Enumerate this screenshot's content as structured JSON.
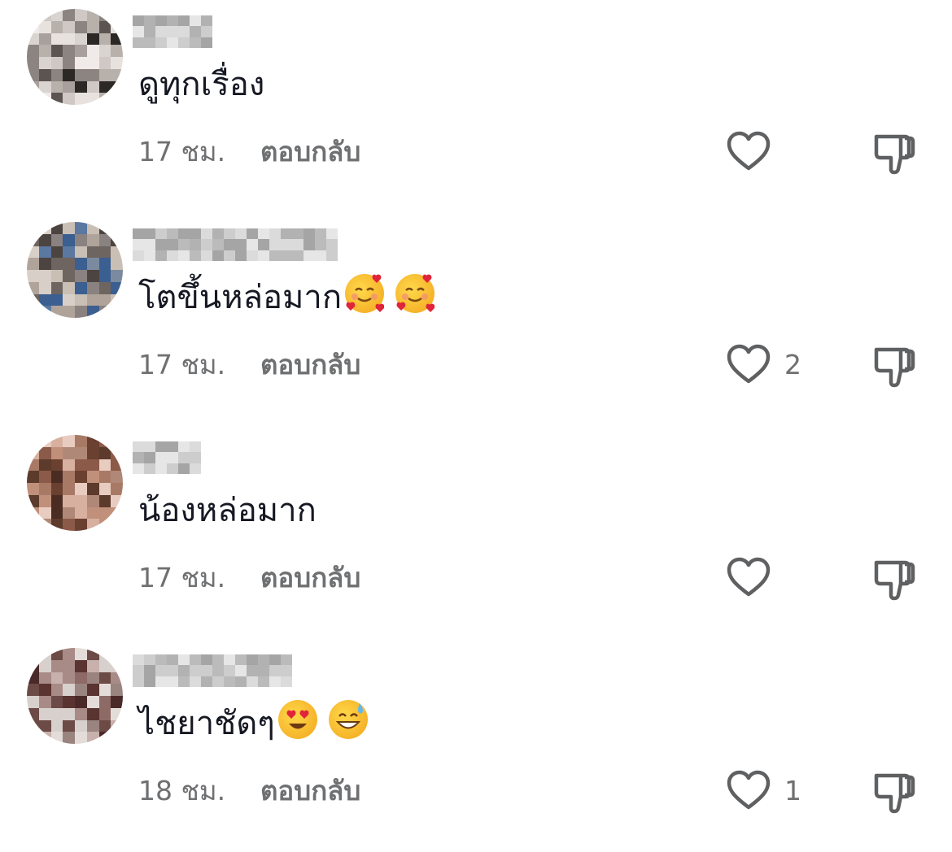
{
  "comments": [
    {
      "text": "ดูทุกเรื่อง",
      "time": "17 ชม.",
      "reply_label": "ตอบกลับ",
      "like_count": "",
      "emojis": []
    },
    {
      "text": "โตขึ้นหล่อมาก",
      "time": "17 ชม.",
      "reply_label": "ตอบกลับ",
      "like_count": "2",
      "emojis": [
        "smiling-face-with-hearts",
        "smiling-face-with-hearts"
      ]
    },
    {
      "text": "น้องหล่อมาก",
      "time": "17 ชม.",
      "reply_label": "ตอบกลับ",
      "like_count": "",
      "emojis": []
    },
    {
      "text": "ไชยาชัดๆ",
      "time": "18 ชม.",
      "reply_label": "ตอบกลับ",
      "like_count": "1",
      "emojis": [
        "heart-eyes",
        "grinning-face-with-sweat"
      ]
    }
  ],
  "colors": {
    "text": "#161823",
    "muted": "#6f7072",
    "icon": "#5f6062"
  }
}
